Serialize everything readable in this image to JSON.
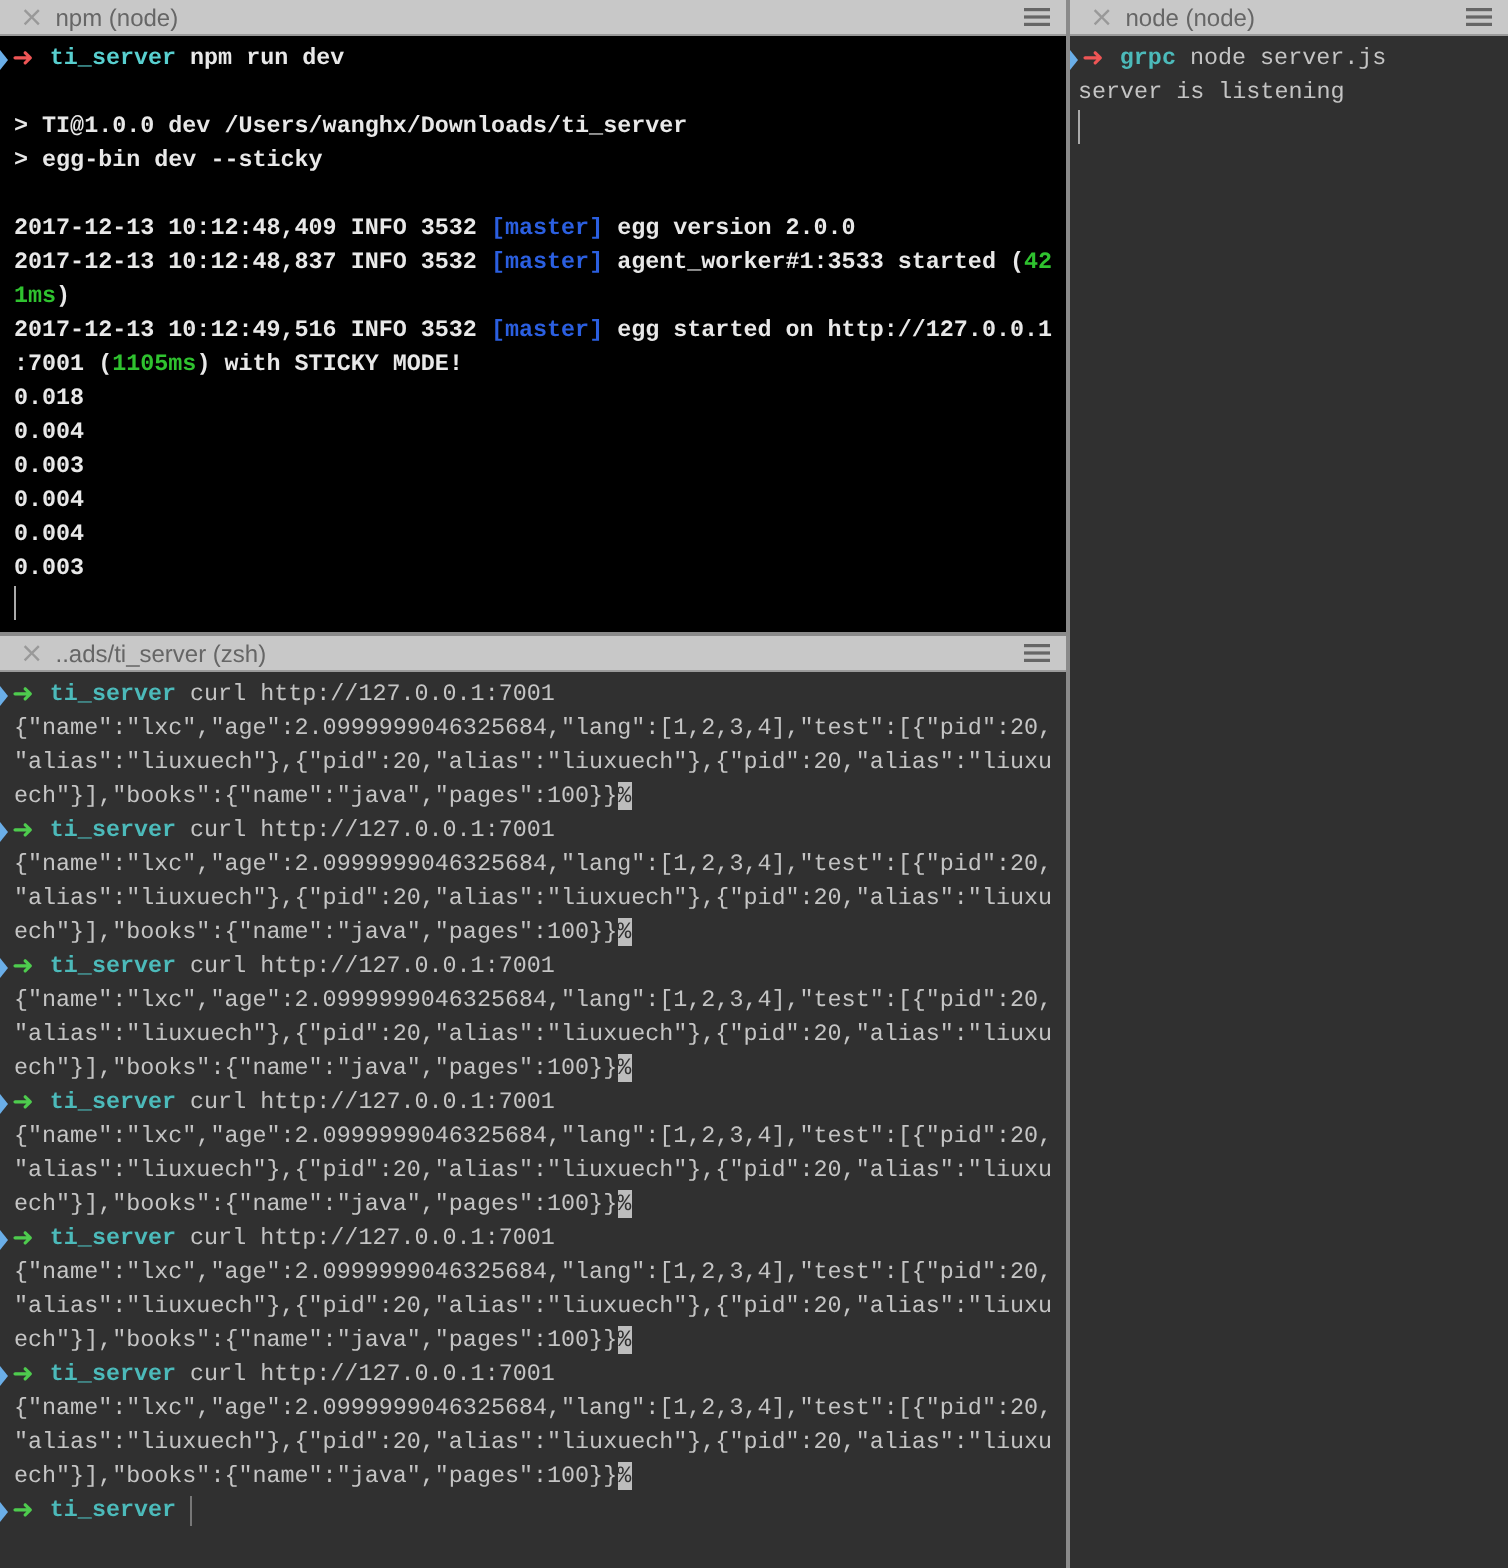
{
  "panes": [
    {
      "title": "npm (node)",
      "close": "×",
      "dimmed": false,
      "lines": [
        {
          "kind": "prompt",
          "failed": true,
          "arrow": "➜",
          "dir": "ti_server",
          "command": "npm run dev"
        },
        {
          "kind": "blank"
        },
        {
          "kind": "output",
          "segments": [
            {
              "kind": "plain",
              "text": "> TI@1.0.0 dev /Users/wanghx/Downloads/ti_server"
            }
          ]
        },
        {
          "kind": "output",
          "segments": [
            {
              "kind": "plain",
              "text": "> egg-bin dev --sticky"
            }
          ]
        },
        {
          "kind": "blank"
        },
        {
          "kind": "output",
          "segments": [
            {
              "kind": "plain",
              "text": "2017-12-13 10:12:48,409 INFO 3532 "
            },
            {
              "kind": "blue",
              "text": "[master]"
            },
            {
              "kind": "plain",
              "text": " egg version 2.0.0"
            }
          ]
        },
        {
          "kind": "output",
          "segments": [
            {
              "kind": "plain",
              "text": "2017-12-13 10:12:48,837 INFO 3532 "
            },
            {
              "kind": "blue",
              "text": "[master]"
            },
            {
              "kind": "plain",
              "text": " agent_worker#1:3533 started ("
            },
            {
              "kind": "green",
              "text": "42"
            }
          ]
        },
        {
          "kind": "output",
          "segments": [
            {
              "kind": "green",
              "text": "1ms"
            },
            {
              "kind": "plain",
              "text": ")"
            }
          ]
        },
        {
          "kind": "output",
          "segments": [
            {
              "kind": "plain",
              "text": "2017-12-13 10:12:49,516 INFO 3532 "
            },
            {
              "kind": "blue",
              "text": "[master]"
            },
            {
              "kind": "plain",
              "text": " egg started on http://127.0.0.1"
            }
          ]
        },
        {
          "kind": "output",
          "segments": [
            {
              "kind": "plain",
              "text": ":7001 ("
            },
            {
              "kind": "green",
              "text": "1105ms"
            },
            {
              "kind": "plain",
              "text": ") with STICKY MODE!"
            }
          ]
        },
        {
          "kind": "output",
          "segments": [
            {
              "kind": "plain",
              "text": "0.018"
            }
          ]
        },
        {
          "kind": "output",
          "segments": [
            {
              "kind": "plain",
              "text": "0.004"
            }
          ]
        },
        {
          "kind": "output",
          "segments": [
            {
              "kind": "plain",
              "text": "0.003"
            }
          ]
        },
        {
          "kind": "output",
          "segments": [
            {
              "kind": "plain",
              "text": "0.004"
            }
          ]
        },
        {
          "kind": "output",
          "segments": [
            {
              "kind": "plain",
              "text": "0.004"
            }
          ]
        },
        {
          "kind": "output",
          "segments": [
            {
              "kind": "plain",
              "text": "0.003"
            }
          ]
        },
        {
          "kind": "cursor"
        }
      ]
    },
    {
      "title": "..ads/ti_server (zsh)",
      "close": "×",
      "dimmed": true,
      "lines": [
        {
          "kind": "prompt",
          "failed": false,
          "arrow": "➜",
          "dir": "ti_server",
          "command": "curl http://127.0.0.1:7001"
        },
        {
          "kind": "output",
          "segments": [
            {
              "kind": "plain",
              "text": "{\"name\":\"lxc\",\"age\":2.0999999046325684,\"lang\":[1,2,3,4],\"test\":[{\"pid\":20,"
            }
          ]
        },
        {
          "kind": "output",
          "segments": [
            {
              "kind": "plain",
              "text": "\"alias\":\"liuxuech\"},{\"pid\":20,\"alias\":\"liuxuech\"},{\"pid\":20,\"alias\":\"liuxu"
            }
          ]
        },
        {
          "kind": "output",
          "segments": [
            {
              "kind": "plain",
              "text": "ech\"}],\"books\":{\"name\":\"java\",\"pages\":100}}"
            },
            {
              "kind": "inverse",
              "text": "%"
            }
          ]
        },
        {
          "kind": "prompt",
          "failed": false,
          "arrow": "➜",
          "dir": "ti_server",
          "command": "curl http://127.0.0.1:7001"
        },
        {
          "kind": "output",
          "segments": [
            {
              "kind": "plain",
              "text": "{\"name\":\"lxc\",\"age\":2.0999999046325684,\"lang\":[1,2,3,4],\"test\":[{\"pid\":20,"
            }
          ]
        },
        {
          "kind": "output",
          "segments": [
            {
              "kind": "plain",
              "text": "\"alias\":\"liuxuech\"},{\"pid\":20,\"alias\":\"liuxuech\"},{\"pid\":20,\"alias\":\"liuxu"
            }
          ]
        },
        {
          "kind": "output",
          "segments": [
            {
              "kind": "plain",
              "text": "ech\"}],\"books\":{\"name\":\"java\",\"pages\":100}}"
            },
            {
              "kind": "inverse",
              "text": "%"
            }
          ]
        },
        {
          "kind": "prompt",
          "failed": false,
          "arrow": "➜",
          "dir": "ti_server",
          "command": "curl http://127.0.0.1:7001"
        },
        {
          "kind": "output",
          "segments": [
            {
              "kind": "plain",
              "text": "{\"name\":\"lxc\",\"age\":2.0999999046325684,\"lang\":[1,2,3,4],\"test\":[{\"pid\":20,"
            }
          ]
        },
        {
          "kind": "output",
          "segments": [
            {
              "kind": "plain",
              "text": "\"alias\":\"liuxuech\"},{\"pid\":20,\"alias\":\"liuxuech\"},{\"pid\":20,\"alias\":\"liuxu"
            }
          ]
        },
        {
          "kind": "output",
          "segments": [
            {
              "kind": "plain",
              "text": "ech\"}],\"books\":{\"name\":\"java\",\"pages\":100}}"
            },
            {
              "kind": "inverse",
              "text": "%"
            }
          ]
        },
        {
          "kind": "prompt",
          "failed": false,
          "arrow": "➜",
          "dir": "ti_server",
          "command": "curl http://127.0.0.1:7001"
        },
        {
          "kind": "output",
          "segments": [
            {
              "kind": "plain",
              "text": "{\"name\":\"lxc\",\"age\":2.0999999046325684,\"lang\":[1,2,3,4],\"test\":[{\"pid\":20,"
            }
          ]
        },
        {
          "kind": "output",
          "segments": [
            {
              "kind": "plain",
              "text": "\"alias\":\"liuxuech\"},{\"pid\":20,\"alias\":\"liuxuech\"},{\"pid\":20,\"alias\":\"liuxu"
            }
          ]
        },
        {
          "kind": "output",
          "segments": [
            {
              "kind": "plain",
              "text": "ech\"}],\"books\":{\"name\":\"java\",\"pages\":100}}"
            },
            {
              "kind": "inverse",
              "text": "%"
            }
          ]
        },
        {
          "kind": "prompt",
          "failed": false,
          "arrow": "➜",
          "dir": "ti_server",
          "command": "curl http://127.0.0.1:7001"
        },
        {
          "kind": "output",
          "segments": [
            {
              "kind": "plain",
              "text": "{\"name\":\"lxc\",\"age\":2.0999999046325684,\"lang\":[1,2,3,4],\"test\":[{\"pid\":20,"
            }
          ]
        },
        {
          "kind": "output",
          "segments": [
            {
              "kind": "plain",
              "text": "\"alias\":\"liuxuech\"},{\"pid\":20,\"alias\":\"liuxuech\"},{\"pid\":20,\"alias\":\"liuxu"
            }
          ]
        },
        {
          "kind": "output",
          "segments": [
            {
              "kind": "plain",
              "text": "ech\"}],\"books\":{\"name\":\"java\",\"pages\":100}}"
            },
            {
              "kind": "inverse",
              "text": "%"
            }
          ]
        },
        {
          "kind": "prompt",
          "failed": false,
          "arrow": "➜",
          "dir": "ti_server",
          "command": "curl http://127.0.0.1:7001"
        },
        {
          "kind": "output",
          "segments": [
            {
              "kind": "plain",
              "text": "{\"name\":\"lxc\",\"age\":2.0999999046325684,\"lang\":[1,2,3,4],\"test\":[{\"pid\":20,"
            }
          ]
        },
        {
          "kind": "output",
          "segments": [
            {
              "kind": "plain",
              "text": "\"alias\":\"liuxuech\"},{\"pid\":20,\"alias\":\"liuxuech\"},{\"pid\":20,\"alias\":\"liuxu"
            }
          ]
        },
        {
          "kind": "output",
          "segments": [
            {
              "kind": "plain",
              "text": "ech\"}],\"books\":{\"name\":\"java\",\"pages\":100}}"
            },
            {
              "kind": "inverse",
              "text": "%"
            }
          ]
        },
        {
          "kind": "prompt",
          "failed": false,
          "arrow": "➜",
          "dir": "ti_server",
          "cursor": true
        }
      ]
    },
    {
      "title": "node (node)",
      "close": "×",
      "dimmed": true,
      "lines": [
        {
          "kind": "prompt",
          "failed": true,
          "arrow": "➜",
          "dir": "grpc",
          "command": "node server.js"
        },
        {
          "kind": "output",
          "segments": [
            {
              "kind": "plain",
              "text": "server is listening"
            }
          ]
        },
        {
          "kind": "cursor"
        }
      ]
    }
  ]
}
